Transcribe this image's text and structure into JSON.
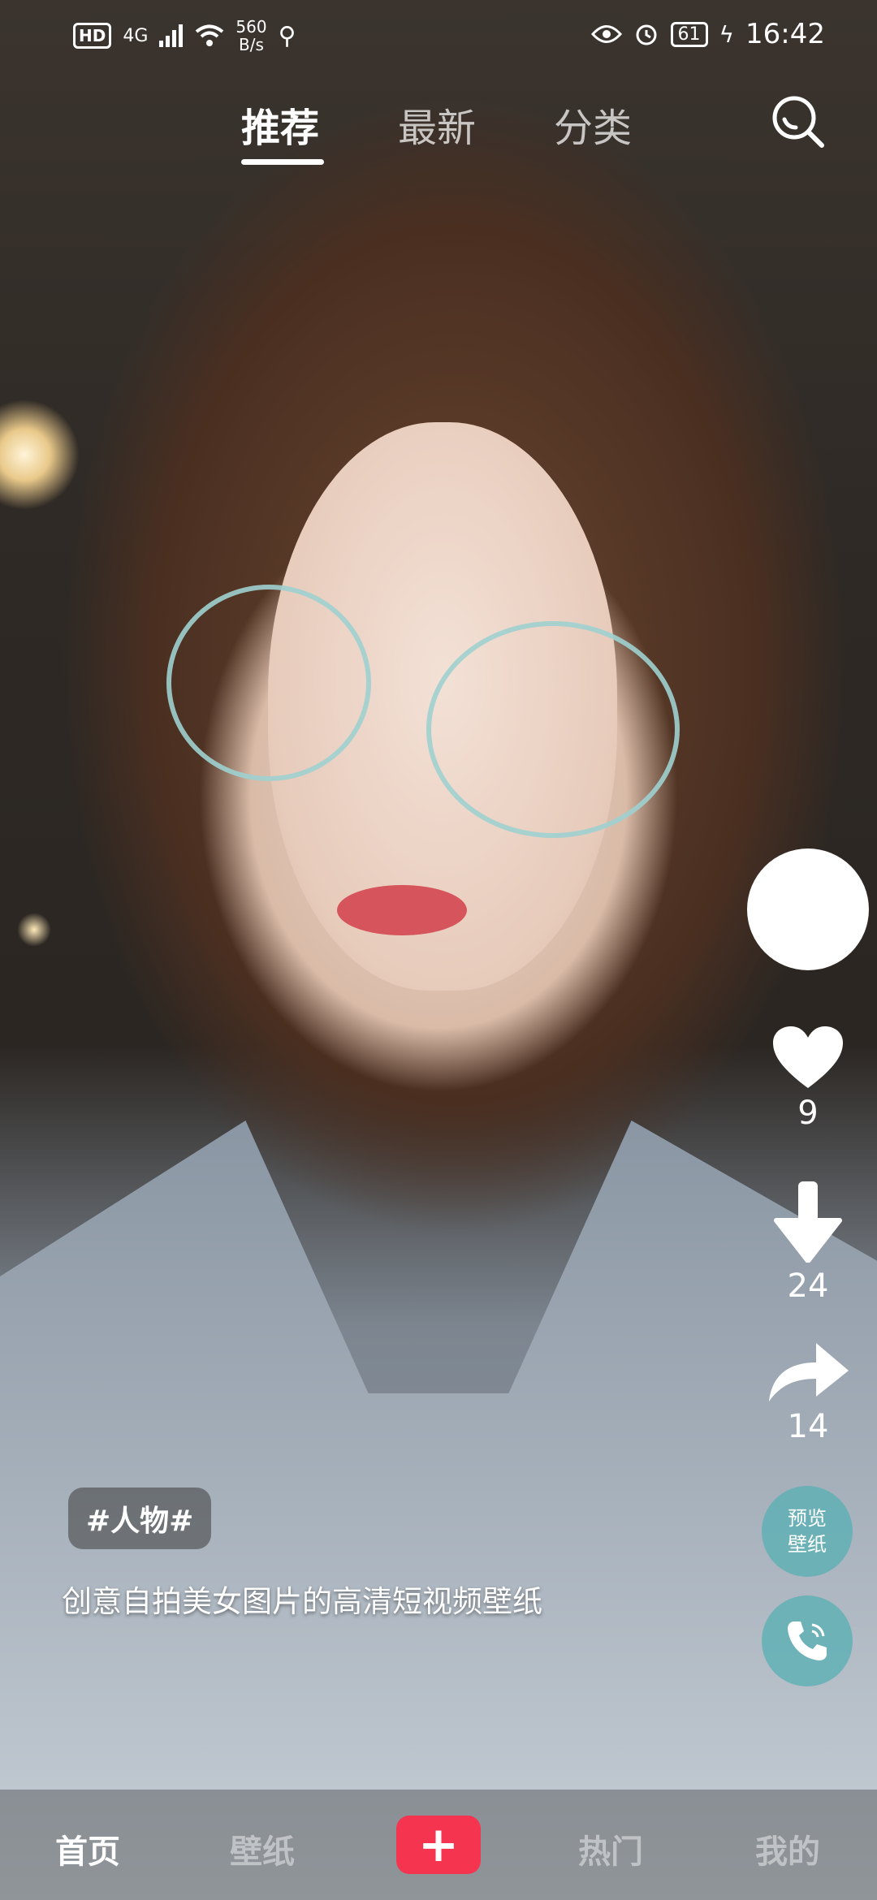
{
  "status_bar": {
    "hd": "HD",
    "network": "4G",
    "speed_value": "560",
    "speed_unit": "B/s",
    "battery": "61",
    "time": "16:42"
  },
  "top_tabs": [
    {
      "label": "推荐",
      "active": true
    },
    {
      "label": "最新",
      "active": false
    },
    {
      "label": "分类",
      "active": false
    }
  ],
  "actions": {
    "like_count": "9",
    "download_count": "24",
    "share_count": "14",
    "preview_line1": "预览",
    "preview_line2": "壁纸"
  },
  "post": {
    "tag": "#人物#",
    "description": "创意自拍美女图片的高清短视频壁纸"
  },
  "bottom_nav": [
    {
      "label": "首页",
      "active": true
    },
    {
      "label": "壁纸",
      "active": false
    },
    {
      "label": "+",
      "active": false
    },
    {
      "label": "热门",
      "active": false
    },
    {
      "label": "我的",
      "active": false
    }
  ],
  "icons": {
    "search": "search-icon",
    "like": "heart-icon",
    "download": "download-arrow-icon",
    "share": "share-arrow-icon",
    "call": "phone-icon"
  },
  "colors": {
    "accent": "#f5354f",
    "action_bubble": "#5aafb4"
  }
}
